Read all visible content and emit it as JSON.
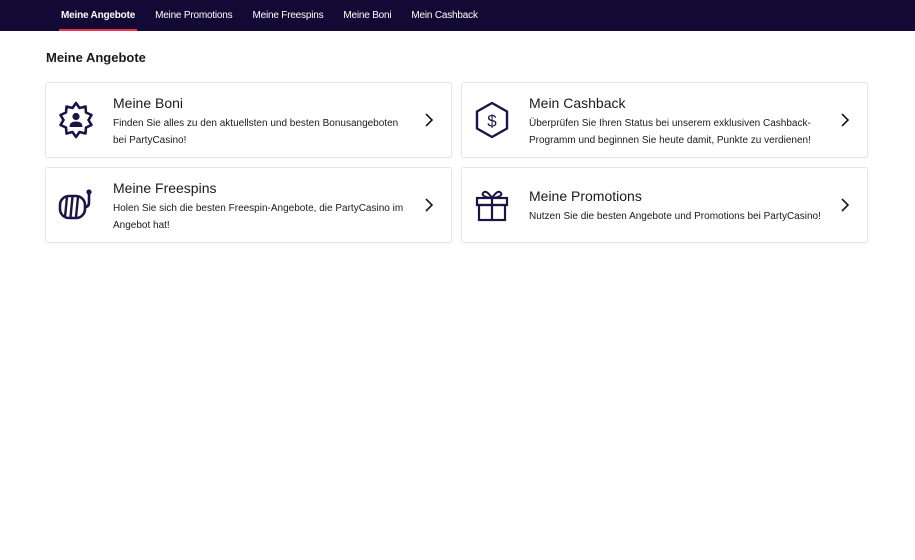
{
  "nav": {
    "tabs": [
      {
        "label": "Meine Angebote",
        "active": true
      },
      {
        "label": "Meine Promotions",
        "active": false
      },
      {
        "label": "Meine Freespins",
        "active": false
      },
      {
        "label": "Meine Boni",
        "active": false
      },
      {
        "label": "Mein Cashback",
        "active": false
      }
    ]
  },
  "page": {
    "title": "Meine Angebote"
  },
  "cards": {
    "boni": {
      "title": "Meine Boni",
      "desc": "Finden Sie alles zu den aktuellsten und besten Bonusangeboten bei PartyCasino!",
      "icon": "gear-user-icon"
    },
    "cashback": {
      "title": "Mein Cashback",
      "desc": "Überprüfen Sie Ihren Status bei unserem exklusiven Cashback-Programm und beginnen Sie heute damit, Punkte zu verdienen!",
      "icon": "dollar-hexagon-icon"
    },
    "freespins": {
      "title": "Meine Freespins",
      "desc": "Holen Sie sich die besten Freespin-Angebote, die PartyCasino im Angebot hat!",
      "icon": "slot-reel-icon"
    },
    "promotions": {
      "title": "Meine Promotions",
      "desc": "Nutzen Sie die besten Angebote und Promotions bei PartyCasino!",
      "icon": "gift-icon"
    }
  },
  "colors": {
    "nav_bg": "#120a35",
    "accent": "#e8334a",
    "icon": "#1b1446"
  }
}
